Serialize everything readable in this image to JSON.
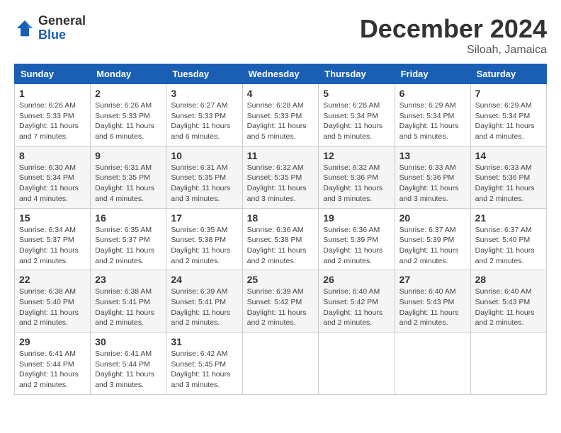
{
  "logo": {
    "general": "General",
    "blue": "Blue"
  },
  "title": "December 2024",
  "location": "Siloah, Jamaica",
  "days_of_week": [
    "Sunday",
    "Monday",
    "Tuesday",
    "Wednesday",
    "Thursday",
    "Friday",
    "Saturday"
  ],
  "weeks": [
    [
      {
        "day": "1",
        "sunrise": "6:26 AM",
        "sunset": "5:33 PM",
        "daylight": "11 hours and 7 minutes."
      },
      {
        "day": "2",
        "sunrise": "6:26 AM",
        "sunset": "5:33 PM",
        "daylight": "11 hours and 6 minutes."
      },
      {
        "day": "3",
        "sunrise": "6:27 AM",
        "sunset": "5:33 PM",
        "daylight": "11 hours and 6 minutes."
      },
      {
        "day": "4",
        "sunrise": "6:28 AM",
        "sunset": "5:33 PM",
        "daylight": "11 hours and 5 minutes."
      },
      {
        "day": "5",
        "sunrise": "6:28 AM",
        "sunset": "5:34 PM",
        "daylight": "11 hours and 5 minutes."
      },
      {
        "day": "6",
        "sunrise": "6:29 AM",
        "sunset": "5:34 PM",
        "daylight": "11 hours and 5 minutes."
      },
      {
        "day": "7",
        "sunrise": "6:29 AM",
        "sunset": "5:34 PM",
        "daylight": "11 hours and 4 minutes."
      }
    ],
    [
      {
        "day": "8",
        "sunrise": "6:30 AM",
        "sunset": "5:34 PM",
        "daylight": "11 hours and 4 minutes."
      },
      {
        "day": "9",
        "sunrise": "6:31 AM",
        "sunset": "5:35 PM",
        "daylight": "11 hours and 4 minutes."
      },
      {
        "day": "10",
        "sunrise": "6:31 AM",
        "sunset": "5:35 PM",
        "daylight": "11 hours and 3 minutes."
      },
      {
        "day": "11",
        "sunrise": "6:32 AM",
        "sunset": "5:35 PM",
        "daylight": "11 hours and 3 minutes."
      },
      {
        "day": "12",
        "sunrise": "6:32 AM",
        "sunset": "5:36 PM",
        "daylight": "11 hours and 3 minutes."
      },
      {
        "day": "13",
        "sunrise": "6:33 AM",
        "sunset": "5:36 PM",
        "daylight": "11 hours and 3 minutes."
      },
      {
        "day": "14",
        "sunrise": "6:33 AM",
        "sunset": "5:36 PM",
        "daylight": "11 hours and 2 minutes."
      }
    ],
    [
      {
        "day": "15",
        "sunrise": "6:34 AM",
        "sunset": "5:37 PM",
        "daylight": "11 hours and 2 minutes."
      },
      {
        "day": "16",
        "sunrise": "6:35 AM",
        "sunset": "5:37 PM",
        "daylight": "11 hours and 2 minutes."
      },
      {
        "day": "17",
        "sunrise": "6:35 AM",
        "sunset": "5:38 PM",
        "daylight": "11 hours and 2 minutes."
      },
      {
        "day": "18",
        "sunrise": "6:36 AM",
        "sunset": "5:38 PM",
        "daylight": "11 hours and 2 minutes."
      },
      {
        "day": "19",
        "sunrise": "6:36 AM",
        "sunset": "5:39 PM",
        "daylight": "11 hours and 2 minutes."
      },
      {
        "day": "20",
        "sunrise": "6:37 AM",
        "sunset": "5:39 PM",
        "daylight": "11 hours and 2 minutes."
      },
      {
        "day": "21",
        "sunrise": "6:37 AM",
        "sunset": "5:40 PM",
        "daylight": "11 hours and 2 minutes."
      }
    ],
    [
      {
        "day": "22",
        "sunrise": "6:38 AM",
        "sunset": "5:40 PM",
        "daylight": "11 hours and 2 minutes."
      },
      {
        "day": "23",
        "sunrise": "6:38 AM",
        "sunset": "5:41 PM",
        "daylight": "11 hours and 2 minutes."
      },
      {
        "day": "24",
        "sunrise": "6:39 AM",
        "sunset": "5:41 PM",
        "daylight": "11 hours and 2 minutes."
      },
      {
        "day": "25",
        "sunrise": "6:39 AM",
        "sunset": "5:42 PM",
        "daylight": "11 hours and 2 minutes."
      },
      {
        "day": "26",
        "sunrise": "6:40 AM",
        "sunset": "5:42 PM",
        "daylight": "11 hours and 2 minutes."
      },
      {
        "day": "27",
        "sunrise": "6:40 AM",
        "sunset": "5:43 PM",
        "daylight": "11 hours and 2 minutes."
      },
      {
        "day": "28",
        "sunrise": "6:40 AM",
        "sunset": "5:43 PM",
        "daylight": "11 hours and 2 minutes."
      }
    ],
    [
      {
        "day": "29",
        "sunrise": "6:41 AM",
        "sunset": "5:44 PM",
        "daylight": "11 hours and 2 minutes."
      },
      {
        "day": "30",
        "sunrise": "6:41 AM",
        "sunset": "5:44 PM",
        "daylight": "11 hours and 3 minutes."
      },
      {
        "day": "31",
        "sunrise": "6:42 AM",
        "sunset": "5:45 PM",
        "daylight": "11 hours and 3 minutes."
      },
      null,
      null,
      null,
      null
    ]
  ]
}
